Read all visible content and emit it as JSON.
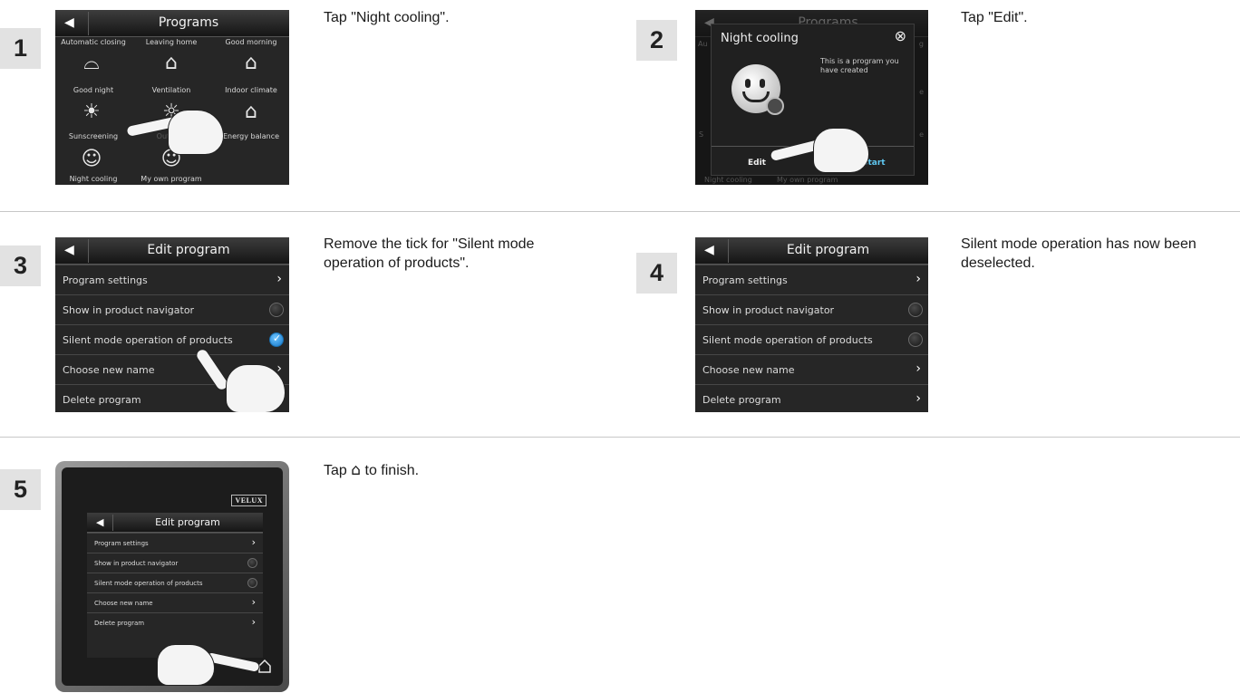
{
  "steps": [
    {
      "number": "1",
      "instruction": "Tap \"Night cooling\"."
    },
    {
      "number": "2",
      "instruction": "Tap \"Edit\"."
    },
    {
      "number": "3",
      "instruction": "Remove the tick for \"Silent mode operation of products\"."
    },
    {
      "number": "4",
      "instruction": "Silent mode operation has now been deselected."
    },
    {
      "number": "5",
      "instruction_pre": "Tap",
      "instruction_icon": "⌂",
      "instruction_post": "to finish."
    }
  ],
  "programs_screen": {
    "title": "Programs",
    "items": [
      "Automatic closing",
      "Leaving home",
      "Good morning",
      "Good night",
      "Ventilation",
      "Indoor climate",
      "Sunscreening",
      "Outdoor",
      "Energy balance",
      "Night cooling",
      "My own program"
    ],
    "icons": [
      "bed-icon",
      "house-vent-icon",
      "house-temp-icon",
      "sunscreen-icon",
      "sun-cloud-icon",
      "energy-icon",
      "smiley-icon",
      "smiley-plus-icon"
    ]
  },
  "dialog_screen": {
    "bg_title": "Programs",
    "title": "Night cooling",
    "description": "This is a program you have created",
    "edit_label": "Edit",
    "start_label": "Start",
    "bg_items": [
      "Night cooling",
      "My own program"
    ],
    "bg_partial_letters": [
      "Au",
      "g",
      "e",
      "S",
      "e"
    ]
  },
  "edit_screen": {
    "title": "Edit program",
    "rows": [
      "Program settings",
      "Show in product navigator",
      "Silent mode operation of products",
      "Choose new name",
      "Delete program"
    ]
  },
  "device": {
    "brand": "VELUX"
  },
  "colors": {
    "badge_bg": "#e2e2e2",
    "screen_bg": "#262626",
    "checked_blue": "#1377c8",
    "start_cyan": "#5fc7f0"
  }
}
